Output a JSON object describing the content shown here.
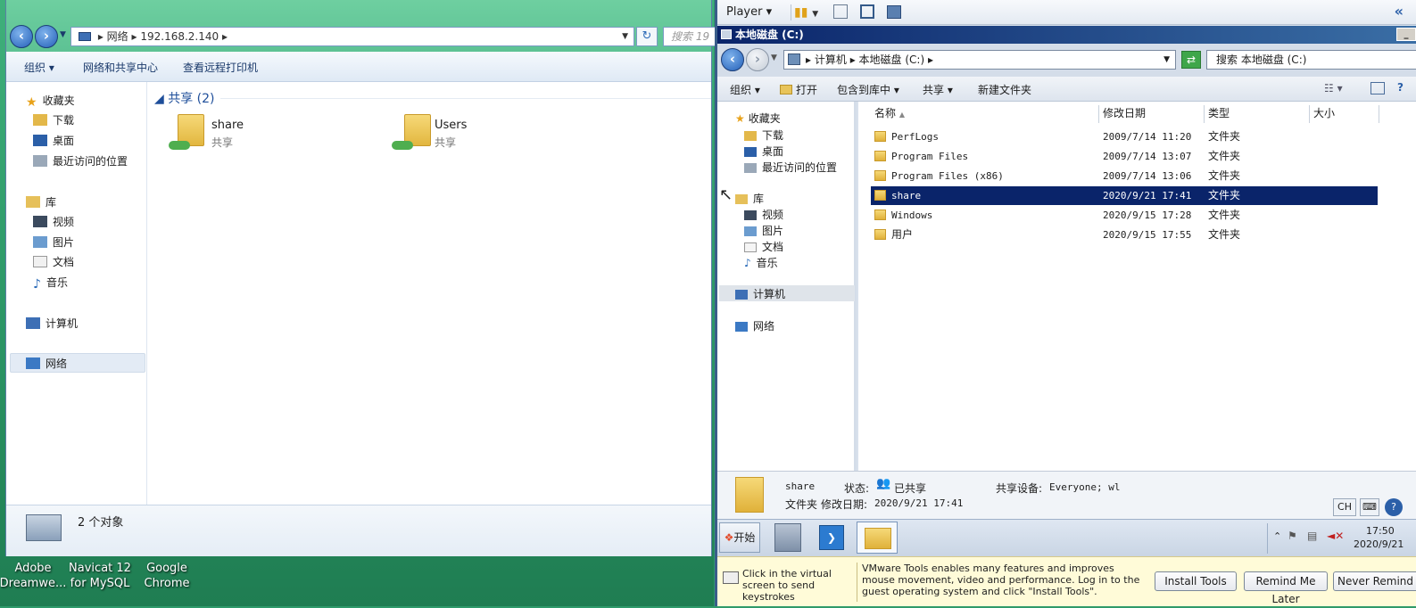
{
  "desktop": {
    "icons": [
      {
        "line1": "Adobe",
        "line2": "Dreamwe..."
      },
      {
        "line1": "Navicat 12",
        "line2": "for MySQL"
      },
      {
        "line1": "Google",
        "line2": "Chrome"
      }
    ]
  },
  "left_window": {
    "address": {
      "segment1": "网络",
      "segment2": "192.168.2.140"
    },
    "search_placeholder": "搜索 19",
    "commands": {
      "organize": "组织",
      "network_center": "网络和共享中心",
      "remote_printers": "查看远程打印机"
    },
    "nav": {
      "favorites": "收藏夹",
      "downloads": "下载",
      "desktop": "桌面",
      "recent": "最近访问的位置",
      "libraries": "库",
      "videos": "视频",
      "pictures": "图片",
      "documents": "文档",
      "music": "音乐",
      "computer": "计算机",
      "network": "网络"
    },
    "group_header": "共享 (2)",
    "shares": [
      {
        "name": "share",
        "type": "共享"
      },
      {
        "name": "Users",
        "type": "共享"
      }
    ],
    "status": "2 个对象"
  },
  "vm": {
    "player_label": "Player",
    "guest_window": {
      "title": "本地磁盘 (C:)",
      "breadcrumb": {
        "seg1": "计算机",
        "seg2": "本地磁盘 (C:)"
      },
      "search": "搜索 本地磁盘 (C:)",
      "commands": {
        "organize": "组织",
        "open": "打开",
        "include": "包含到库中",
        "share": "共享",
        "new_folder": "新建文件夹"
      },
      "nav": {
        "favorites": "收藏夹",
        "downloads": "下载",
        "desktop": "桌面",
        "recent": "最近访问的位置",
        "libraries": "库",
        "videos": "视频",
        "pictures": "图片",
        "documents": "文档",
        "music": "音乐",
        "computer": "计算机",
        "network": "网络"
      },
      "columns": {
        "name": "名称",
        "modified": "修改日期",
        "type": "类型",
        "size": "大小"
      },
      "files": [
        {
          "name": "PerfLogs",
          "modified": "2009/7/14 11:20",
          "type": "文件夹"
        },
        {
          "name": "Program Files",
          "modified": "2009/7/14 13:07",
          "type": "文件夹"
        },
        {
          "name": "Program Files (x86)",
          "modified": "2009/7/14 13:06",
          "type": "文件夹"
        },
        {
          "name": "share",
          "modified": "2020/9/21 17:41",
          "type": "文件夹"
        },
        {
          "name": "Windows",
          "modified": "2020/9/15 17:28",
          "type": "文件夹"
        },
        {
          "name": "用户",
          "modified": "2020/9/15 17:55",
          "type": "文件夹"
        }
      ],
      "details": {
        "name": "share",
        "type": "文件夹",
        "state_label": "状态:",
        "state_value": "已共享",
        "shared_with_label": "共享设备:",
        "shared_with_value": "Everyone; wl",
        "modified_label": "修改日期:",
        "modified_value": "2020/9/21 17:41"
      }
    },
    "taskbar": {
      "start": "开始",
      "ime": "CH",
      "time": "17:50",
      "date": "2020/9/21"
    },
    "banner": {
      "hint": "Click in the virtual screen to send keystrokes",
      "message": "VMware Tools enables many features and improves mouse movement, video and performance. Log in to the guest operating system and click \"Install Tools\".",
      "install": "Install Tools",
      "remind": "Remind Me Later",
      "never": "Never Remind Me"
    }
  }
}
